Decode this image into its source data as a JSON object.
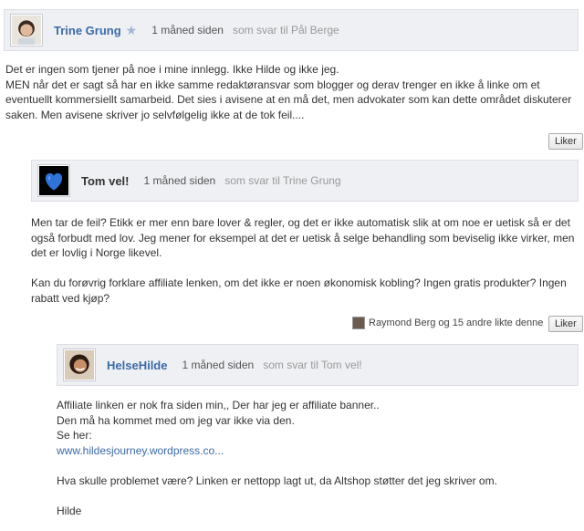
{
  "comments": [
    {
      "author": "Trine Grung",
      "time": "1 måned siden",
      "reply_to": "som svar til Pål Berge",
      "lines": [
        "Det er ingen som tjener på noe i mine innlegg. Ikke Hilde og ikke jeg.",
        "MEN når det er sagt så har en ikke samme redaktøransvar som blogger og derav trenger en ikke å linke om et",
        "eventuellt kommersiellt samarbeid. Det sies i avisene at en må det, men advokater som kan dette området diskuterer",
        "saken. Men avisene skriver jo selvfølgelig ikke at de tok feil...."
      ],
      "like_label": "Liker"
    },
    {
      "author": "Tom vel!",
      "time": "1 måned siden",
      "reply_to": "som svar til Trine Grung",
      "para1": [
        "Men tar de feil? Etikk er mer enn bare lover & regler, og det er ikke automatisk slik at om noe er uetisk så er det",
        "også forbudt med lov. Jeg mener for eksempel at det er uetisk å selge behandling som beviselig ikke virker, men",
        "det er lovlig i Norge likevel."
      ],
      "para2": [
        "Kan du forøvrig forklare affiliate lenken, om det ikke er noen økonomisk kobling? Ingen gratis produkter? Ingen",
        "rabatt ved kjøp?"
      ],
      "likes_text": "Raymond Berg og 15 andre likte denne",
      "like_label": "Liker"
    },
    {
      "author": "HelseHilde",
      "time": "1 måned siden",
      "reply_to": "som svar til Tom vel!",
      "para1": [
        "Affiliate linken er nok fra siden min,, Der har jeg er affiliate banner..",
        "Den må ha kommet med om jeg var ikke via den.",
        "Se her:"
      ],
      "link": "www.hildesjourney.wordpress.co...",
      "para2": "Hva skulle problemet være? Linken er nettopp lagt ut, da Altshop støtter det jeg skriver om.",
      "signature": "Hilde"
    }
  ]
}
